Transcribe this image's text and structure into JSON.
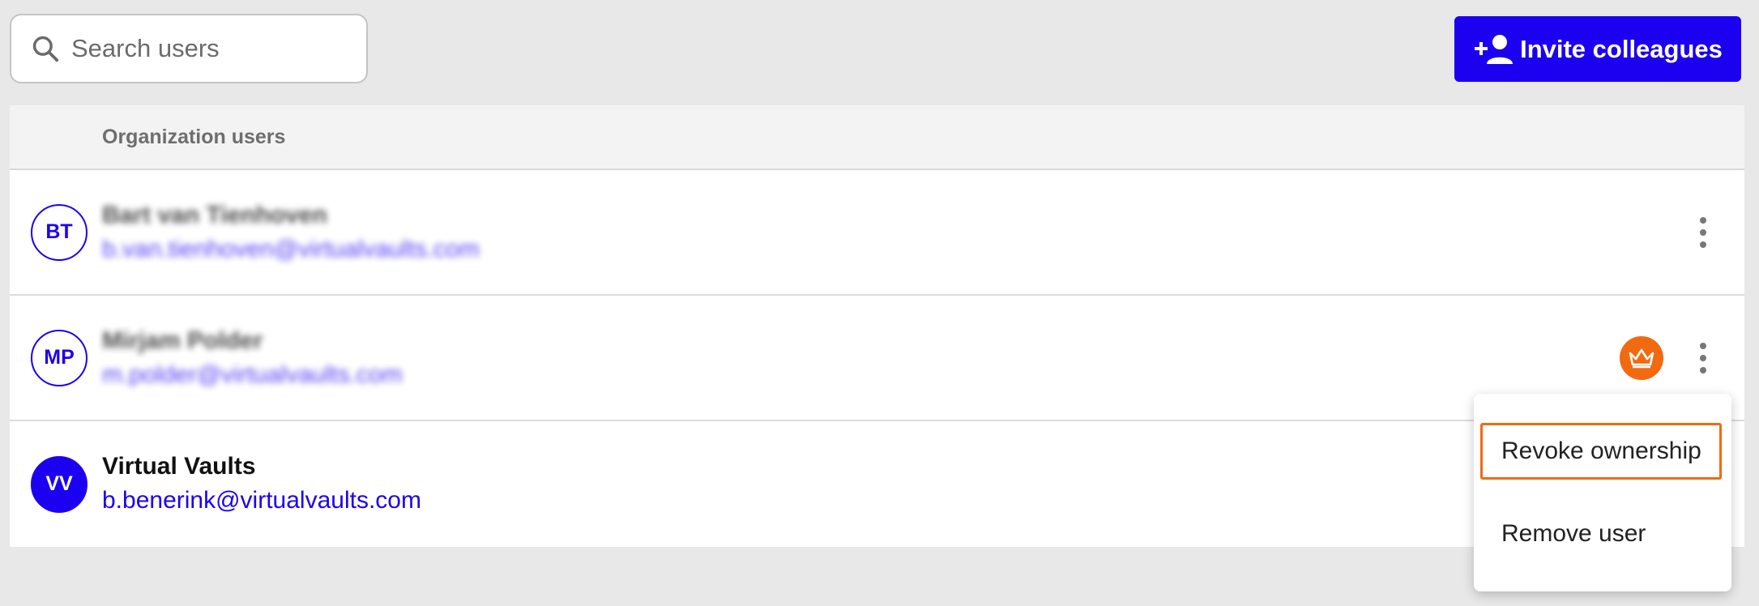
{
  "search": {
    "placeholder": "Search users"
  },
  "invite_button": {
    "label": "Invite colleagues"
  },
  "table": {
    "header": "Organization users",
    "users": [
      {
        "initials": "BT",
        "name": "Bart van Tienhoven",
        "email": "b.van.tienhoven@virtualvaults.com",
        "blurred": true
      },
      {
        "initials": "MP",
        "name": "Mirjam Polder",
        "email": "m.polder@virtualvaults.com",
        "blurred": true,
        "owner": true
      },
      {
        "initials": "VV",
        "name": "Virtual Vaults",
        "email": "b.benerink@virtualvaults.com",
        "blurred": false
      }
    ]
  },
  "menu": {
    "items": [
      {
        "label": "Revoke ownership"
      },
      {
        "label": "Remove user"
      }
    ]
  },
  "colors": {
    "accent": "#1c00f0",
    "owner_badge": "#f26a0f",
    "background": "#e8e8e8"
  },
  "icons": {
    "search": "search-icon",
    "invite": "add-person-icon",
    "owner": "crown-icon",
    "menu": "more-vertical-icon"
  }
}
